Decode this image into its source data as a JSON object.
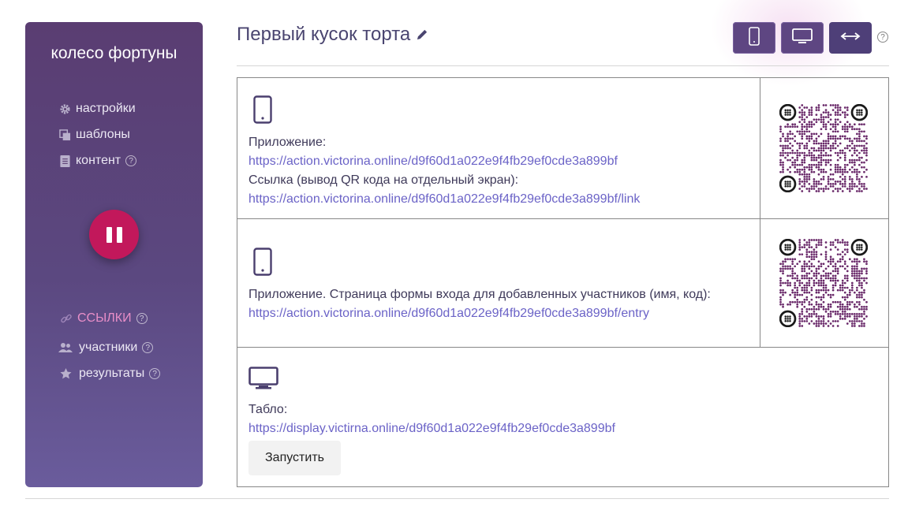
{
  "sidebar": {
    "title": "колесо фортуны",
    "menu": [
      {
        "label": "настройки",
        "icon": "gear-icon"
      },
      {
        "label": "шаблоны",
        "icon": "copy-icon"
      },
      {
        "label": "контент",
        "icon": "document-icon",
        "help": "?"
      }
    ],
    "pause_label": "pause",
    "menu2": [
      {
        "label": "ССЫЛКИ",
        "icon": "link-icon",
        "help": "?",
        "active": true
      },
      {
        "label": "участники",
        "icon": "users-icon",
        "help": "?"
      },
      {
        "label": "результаты",
        "icon": "star-icon",
        "help": "?"
      }
    ]
  },
  "header": {
    "title": "Первый кусок торта",
    "help": "?"
  },
  "links": {
    "app_label": "Приложение:",
    "app_url": "https://action.victorina.online/d9f60d1a022e9f4fb29ef0cde3a899bf",
    "qr_label": "Ссылка (вывод QR кода на отдельный экран):",
    "qr_url": "https://action.victorina.online/d9f60d1a022e9f4fb29ef0cde3a899bf/link",
    "entry_label": "Приложение. Страница формы входа для добавленных участников (имя, код):",
    "entry_url": "https://action.victorina.online/d9f60d1a022e9f4fb29ef0cde3a899bf/entry",
    "display_label": "Табло:",
    "display_url": "https://display.victirna.online/d9f60d1a022e9f4fb29ef0cde3a899bf",
    "launch_button": "Запустить"
  },
  "colors": {
    "sidebar_top": "#5a3d72",
    "sidebar_bottom": "#6a5c9c",
    "accent": "#c2185b",
    "link": "#6b63c7",
    "qr": "#6a2a6a"
  }
}
